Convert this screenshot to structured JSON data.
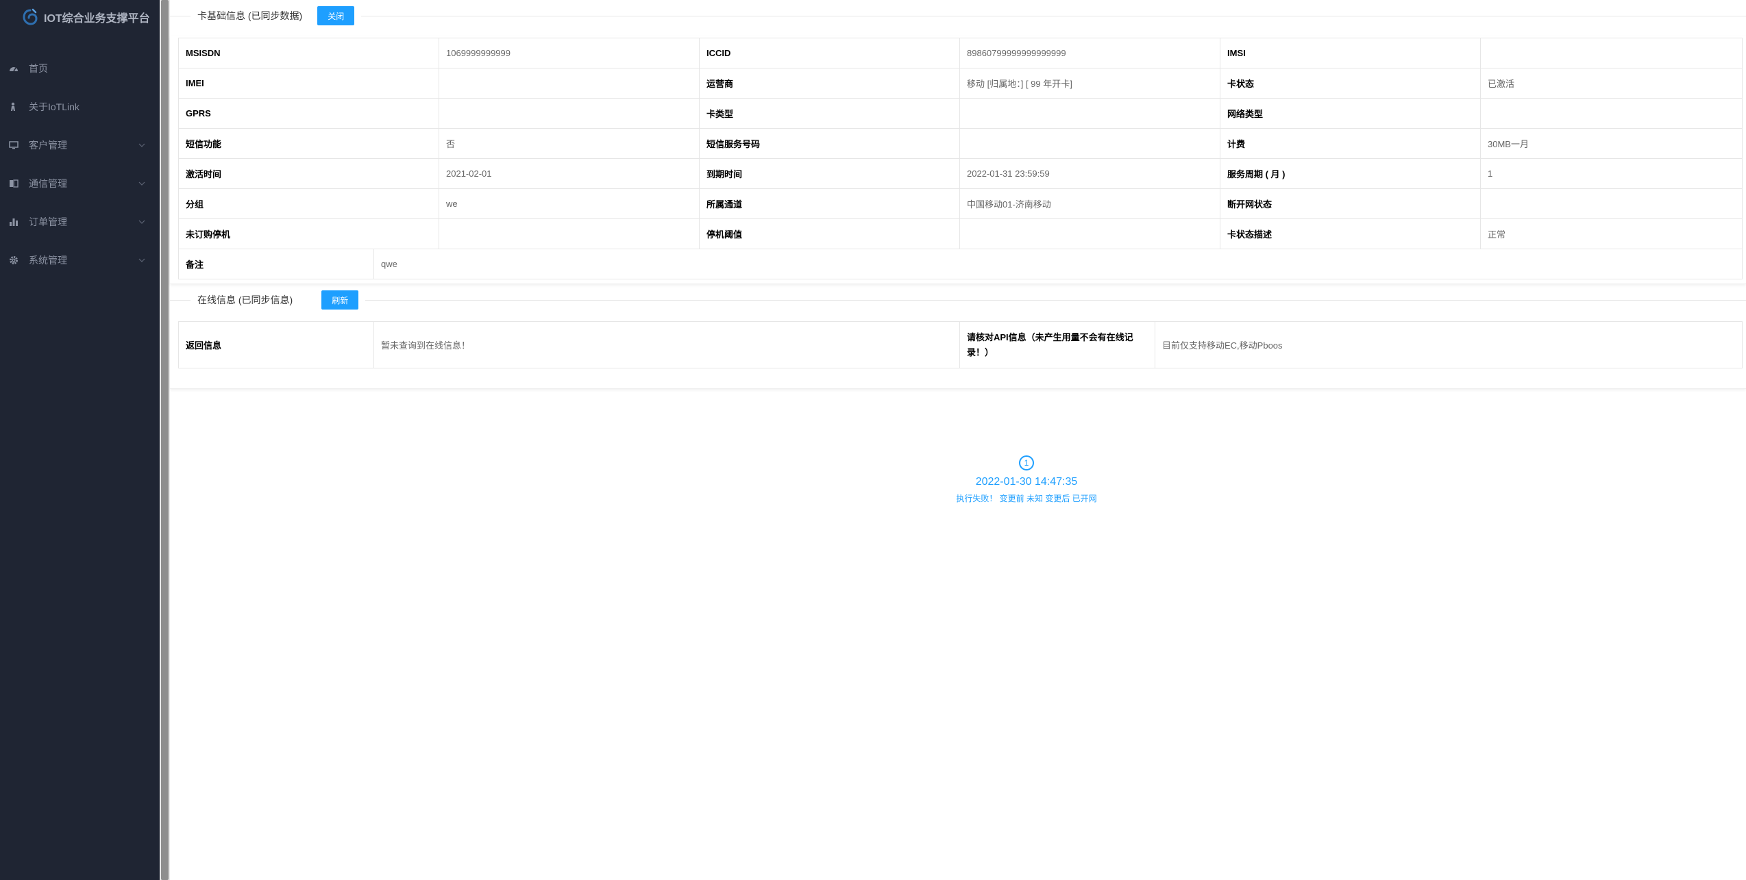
{
  "app": {
    "title": "IOT综合业务支撑平台"
  },
  "sidebar": {
    "items": [
      {
        "label": "首页",
        "icon": "dashboard-icon",
        "has_children": false
      },
      {
        "label": "关于IoTLink",
        "icon": "person-icon",
        "has_children": false
      },
      {
        "label": "客户管理",
        "icon": "monitor-icon",
        "has_children": true
      },
      {
        "label": "通信管理",
        "icon": "book-icon",
        "has_children": true
      },
      {
        "label": "订单管理",
        "icon": "bar-chart-icon",
        "has_children": true
      },
      {
        "label": "系统管理",
        "icon": "gear-icon",
        "has_children": true
      }
    ]
  },
  "card_info": {
    "legend": "卡基础信息 (已同步数据)",
    "close_label": "关闭",
    "rows": [
      [
        {
          "k": "MSISDN",
          "v": "1069999999999"
        },
        {
          "k": "ICCID",
          "v": "89860799999999999999"
        },
        {
          "k": "IMSI",
          "v": ""
        }
      ],
      [
        {
          "k": "IMEI",
          "v": ""
        },
        {
          "k": "运营商",
          "v": "移动 [归属地：] [ 99 年开卡]"
        },
        {
          "k": "卡状态",
          "v": "已激活"
        }
      ],
      [
        {
          "k": "GPRS",
          "v": ""
        },
        {
          "k": "卡类型",
          "v": ""
        },
        {
          "k": "网络类型",
          "v": ""
        }
      ],
      [
        {
          "k": "短信功能",
          "v": "否"
        },
        {
          "k": "短信服务号码",
          "v": ""
        },
        {
          "k": "计费",
          "v": "30MB一月"
        }
      ],
      [
        {
          "k": "激活时间",
          "v": "2021-02-01"
        },
        {
          "k": "到期时间",
          "v": "2022-01-31 23:59:59"
        },
        {
          "k": "服务周期 ( 月 )",
          "v": "1"
        }
      ],
      [
        {
          "k": "分组",
          "v": "we"
        },
        {
          "k": "所属通道",
          "v": "中国移动01-济南移动"
        },
        {
          "k": "断开网状态",
          "v": ""
        }
      ],
      [
        {
          "k": "未订购停机",
          "v": ""
        },
        {
          "k": "停机阈值",
          "v": ""
        },
        {
          "k": "卡状态描述",
          "v": "正常"
        }
      ]
    ],
    "remark_key": "备注",
    "remark_value": "qwe"
  },
  "online_info": {
    "legend": "在线信息 (已同步信息)",
    "refresh_label": "刷新",
    "return_key": "返回信息",
    "return_value": "暂未查询到在线信息！",
    "api_key": "请核对API信息（未产生用量不会有在线记录！）",
    "api_value": "目前仅支持移动EC,移动Pboos"
  },
  "timeline": {
    "index": "1",
    "time": "2022-01-30 14:47:35",
    "message": "执行失败！ 变更前 未知 变更后 已开网"
  },
  "colors": {
    "sidebar_bg": "#1f2533",
    "accent": "#1e9fff"
  }
}
